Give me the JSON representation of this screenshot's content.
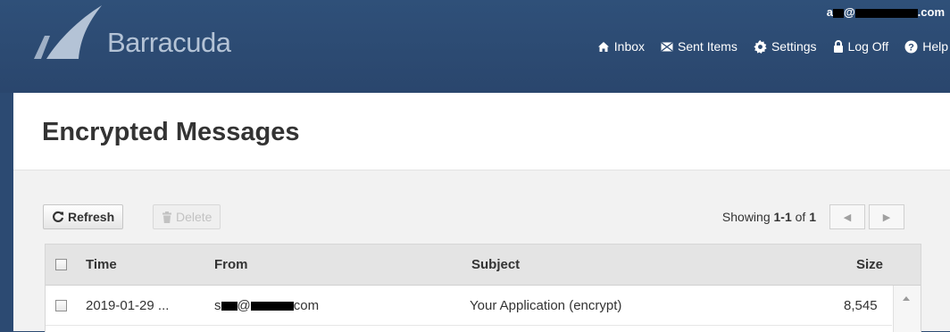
{
  "brand": {
    "name": "Barracuda"
  },
  "user": {
    "email_prefix": "a",
    "email_mid": "@",
    "email_suffix": ".com"
  },
  "nav": {
    "inbox": "Inbox",
    "sent": "Sent Items",
    "settings": "Settings",
    "logoff": "Log Off",
    "help": "Help"
  },
  "page": {
    "title": "Encrypted Messages"
  },
  "toolbar": {
    "refresh": "Refresh",
    "delete": "Delete",
    "showing_prefix": "Showing ",
    "showing_range": "1-1",
    "showing_of": " of ",
    "showing_total": "1"
  },
  "table": {
    "headers": {
      "time": "Time",
      "from": "From",
      "subject": "Subject",
      "size": "Size"
    },
    "rows": [
      {
        "time": "2019-01-29 ...",
        "from_prefix": "s",
        "from_mid": "@",
        "from_suffix": "com",
        "subject": "Your Application (encrypt)",
        "size": "8,545"
      }
    ]
  },
  "colors": {
    "header_bg": "#2c4a72",
    "logo_text": "#b4c3d6",
    "panel_bg": "#f2f2f2"
  },
  "icons": [
    "home-icon",
    "envelope-icon",
    "gear-icon",
    "lock-icon",
    "help-icon",
    "refresh-icon",
    "trash-icon"
  ]
}
